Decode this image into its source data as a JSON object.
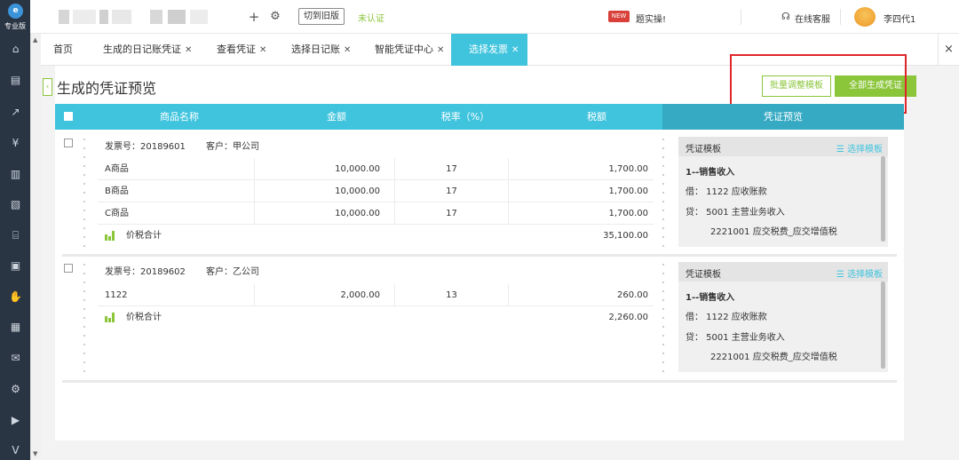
{
  "app": {
    "edition": "专业版",
    "logo_glyph": "e"
  },
  "topbar": {
    "add_icon": "plus-icon",
    "settings_icon": "gear-icon",
    "switch_label": "切到旧版",
    "verify_status": "未认证",
    "promo_badge": "NEW",
    "promo_label": "题实操!",
    "service_label": "在线客服",
    "user_name": "李四代1"
  },
  "sidebar": {
    "icons": [
      "home-icon",
      "ledger-icon",
      "chart-icon",
      "money-bag-icon",
      "book-icon",
      "document-icon",
      "bank-icon",
      "report-icon",
      "hand-coin-icon",
      "receipt-icon",
      "inbox-icon",
      "settings-icon",
      "media-icon",
      "v-icon"
    ]
  },
  "tabs": [
    {
      "label": "首页",
      "closable": false
    },
    {
      "label": "生成的日记账凭证",
      "closable": true
    },
    {
      "label": "查看凭证",
      "closable": true
    },
    {
      "label": "选择日记账",
      "closable": true
    },
    {
      "label": "智能凭证中心",
      "closable": true
    },
    {
      "label": "选择发票",
      "closable": true,
      "active": true
    }
  ],
  "close_all": "×",
  "page": {
    "title": "生成的凭证预览",
    "batch_button": "批量调整模板",
    "generate_all_button": "全部生成凭证"
  },
  "table": {
    "headers": {
      "name": "商品名称",
      "amount": "金额",
      "rate": "税率（%）",
      "tax": "税额",
      "preview": "凭证预览"
    }
  },
  "invoices": [
    {
      "invoice_label": "发票号：20189601",
      "customer_label": "客户：甲公司",
      "items": [
        {
          "name": "A商品",
          "amount": "10,000.00",
          "rate": "17",
          "tax": "1,700.00"
        },
        {
          "name": "B商品",
          "amount": "10,000.00",
          "rate": "17",
          "tax": "1,700.00"
        },
        {
          "name": "C商品",
          "amount": "10,000.00",
          "rate": "17",
          "tax": "1,700.00"
        }
      ],
      "total_label": "价税合计",
      "total_value": "35,100.00",
      "voucher": {
        "template_label": "凭证模板",
        "select_label": "☰ 选择模板",
        "template_name": "1--销售收入",
        "debit": "借：  1122 应收账款",
        "credit": "贷：  5001 主营业务收入",
        "credit2": "2221001 应交税费_应交增值税"
      }
    },
    {
      "invoice_label": "发票号：20189602",
      "customer_label": "客户：乙公司",
      "items": [
        {
          "name": "1122",
          "amount": "2,000.00",
          "rate": "13",
          "tax": "260.00"
        }
      ],
      "total_label": "价税合计",
      "total_value": "2,260.00",
      "voucher": {
        "template_label": "凭证模板",
        "select_label": "☰ 选择模板",
        "template_name": "1--销售收入",
        "debit": "借：  1122 应收账款",
        "credit": "贷：  5001 主营业务收入",
        "credit2": "2221001 应交税费_应交增值税"
      }
    }
  ],
  "colors": {
    "accent": "#40c4de",
    "accent_dark": "#36aac3",
    "green": "#8ac53a",
    "highlight": "#e0262a",
    "sidebar": "#2a3544"
  }
}
